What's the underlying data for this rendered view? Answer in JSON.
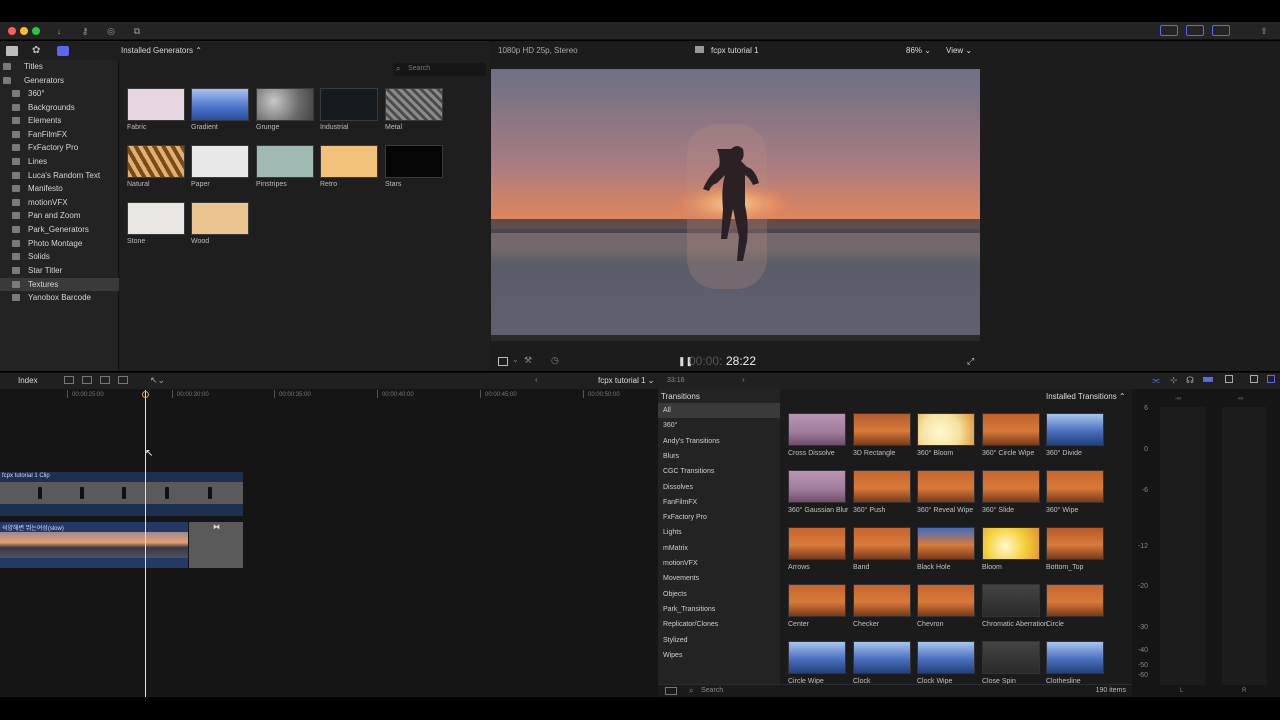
{
  "topbar": {
    "import_icon": "download-icon",
    "keywords_icon": "key-icon",
    "check_icon": "checkmark-icon",
    "tag_icon": "tag-icon"
  },
  "browser": {
    "dropdown_label": "Installed Generators",
    "search_placeholder": "Search",
    "sidebar": [
      {
        "label": "Titles",
        "level": 0
      },
      {
        "label": "Generators",
        "level": 0
      },
      {
        "label": "360°",
        "level": 1
      },
      {
        "label": "Backgrounds",
        "level": 1
      },
      {
        "label": "Elements",
        "level": 1
      },
      {
        "label": "FanFilmFX",
        "level": 1
      },
      {
        "label": "FxFactory Pro",
        "level": 1
      },
      {
        "label": "Lines",
        "level": 1
      },
      {
        "label": "Luca's Random Text",
        "level": 1
      },
      {
        "label": "Manifesto",
        "level": 1
      },
      {
        "label": "motionVFX",
        "level": 1
      },
      {
        "label": "Pan and Zoom",
        "level": 1
      },
      {
        "label": "Park_Generators",
        "level": 1
      },
      {
        "label": "Photo Montage",
        "level": 1
      },
      {
        "label": "Solids",
        "level": 1
      },
      {
        "label": "Star Titler",
        "level": 1
      },
      {
        "label": "Textures",
        "level": 1,
        "selected": true
      },
      {
        "label": "Yanobox Barcode",
        "level": 1
      }
    ],
    "generators": [
      {
        "label": "Fabric",
        "color": "#e8d5e2"
      },
      {
        "label": "Gradient",
        "color": "#4a72c8"
      },
      {
        "label": "Grunge",
        "color": "#8a8a8a"
      },
      {
        "label": "Industrial",
        "color": "#151a1f"
      },
      {
        "label": "Metal",
        "color": "#6e6e6e"
      },
      {
        "label": "Natural",
        "color": "#b07a3a"
      },
      {
        "label": "Paper",
        "color": "#e8e8e8"
      },
      {
        "label": "Pinstripes",
        "color": "#9fbab3"
      },
      {
        "label": "Retro",
        "color": "#f2c27a"
      },
      {
        "label": "Stars",
        "color": "#050505"
      },
      {
        "label": "Stone",
        "color": "#e9e6e2"
      },
      {
        "label": "Wood",
        "color": "#ebc48f"
      }
    ]
  },
  "viewer": {
    "format": "1080p HD 25p, Stereo",
    "title": "fcpx tutorial 1",
    "zoom": "86%",
    "view_label": "View",
    "timecode_dim": "00:00:",
    "timecode": "28:22"
  },
  "timeline_toolbar": {
    "index_label": "Index",
    "project": "fcpx tutorial 1",
    "duration": "33:16"
  },
  "timeline": {
    "ruler": [
      "00:00:25:00",
      "00:00:30:00",
      "00:00:35:00",
      "00:00:40:00",
      "00:00:45:00",
      "00:00:50:00"
    ],
    "clip1_label": "fcpx tutorial 1 Clip",
    "clip2_label": "석양해변 뛰는여성(slow)"
  },
  "transitions": {
    "header": "Transitions",
    "dropdown_label": "Installed Transitions",
    "categories": [
      "All",
      "360°",
      "Andy's Transitions",
      "Blurs",
      "CGC Transitions",
      "Dissolves",
      "FanFilmFX",
      "FxFactory Pro",
      "Lights",
      "mMatrix",
      "motionVFX",
      "Movements",
      "Objects",
      "Park_Transitions",
      "Replicator/Clones",
      "Stylized",
      "Wipes"
    ],
    "items": [
      {
        "label": "Cross Dissolve",
        "color": "#a07a9a"
      },
      {
        "label": "3D Rectangle",
        "color": "#b45c2e"
      },
      {
        "label": "360° Bloom",
        "color": "#f5e2a0"
      },
      {
        "label": "360° Circle Wipe",
        "color": "#c25f2d"
      },
      {
        "label": "360° Divide",
        "color": "#4a6fbf"
      },
      {
        "label": "360° Gaussian Blur",
        "color": "#a07a9a"
      },
      {
        "label": "360° Push",
        "color": "#c7652d"
      },
      {
        "label": "360° Reveal Wipe",
        "color": "#c7652d"
      },
      {
        "label": "360° Slide",
        "color": "#c7652d"
      },
      {
        "label": "360° Wipe",
        "color": "#c7652d"
      },
      {
        "label": "Arrows",
        "color": "#c7652d"
      },
      {
        "label": "Band",
        "color": "#c7652d"
      },
      {
        "label": "Black Hole",
        "color": "#3f6bc4"
      },
      {
        "label": "Bloom",
        "color": "#f5d23a"
      },
      {
        "label": "Bottom_Top",
        "color": "#b85a28"
      },
      {
        "label": "Center",
        "color": "#c7652d"
      },
      {
        "label": "Checker",
        "color": "#c7652d"
      },
      {
        "label": "Chevron",
        "color": "#c7652d"
      },
      {
        "label": "Chromatic Aberration",
        "color": "#333333"
      },
      {
        "label": "Circle",
        "color": "#c7652d"
      },
      {
        "label": "Circle Wipe",
        "color": "#4a6fbf"
      },
      {
        "label": "Clock",
        "color": "#4a6fbf"
      },
      {
        "label": "Clock Wipe",
        "color": "#4a6fbf"
      },
      {
        "label": "Close Spin",
        "color": "#222222"
      },
      {
        "label": "Clothesline",
        "color": "#4a6fbf"
      }
    ],
    "search_placeholder": "Search",
    "count": "190 items"
  },
  "meters": {
    "scale": [
      "6",
      "0",
      "-6",
      "-12",
      "-20",
      "-30",
      "-40",
      "-50",
      "-60"
    ],
    "channels": [
      "L",
      "R"
    ],
    "peak": "-∞"
  },
  "colors": {
    "accent": "#5b67f0",
    "clip_blue": "#2a3f63",
    "playhead": "#e0e0e0"
  }
}
